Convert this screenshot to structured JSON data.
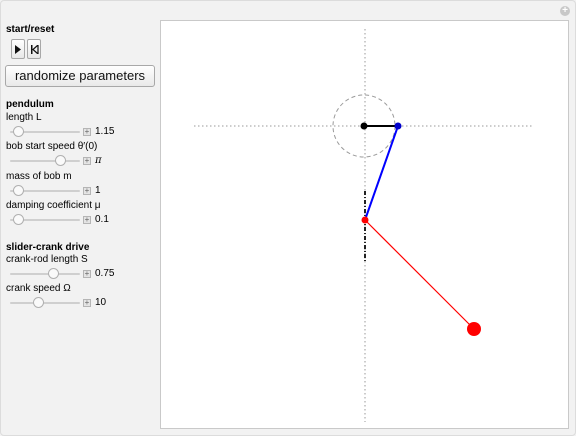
{
  "controls": {
    "start_reset_label": "start/reset",
    "randomize_label": "randomize parameters"
  },
  "pendulum": {
    "title": "pendulum",
    "length_label": "length L",
    "length_value": "1.15",
    "length_fraction": 0.12,
    "start_speed_label": "bob start speed θ′(0)",
    "start_speed_value": "π",
    "start_speed_fraction": 0.72,
    "mass_label": "mass of bob m",
    "mass_value": "1",
    "mass_fraction": 0.12,
    "damping_label": "damping coefficient μ",
    "damping_value": "0.1",
    "damping_fraction": 0.12
  },
  "slider_crank": {
    "title": "slider-crank drive",
    "crank_rod_label": "crank-rod length S",
    "crank_rod_value": "0.75",
    "crank_rod_fraction": 0.62,
    "crank_speed_label": "crank speed Ω",
    "crank_speed_value": "10",
    "crank_speed_fraction": 0.4
  },
  "colors": {
    "crank_arm": "#000000",
    "connecting_rod": "#0000ff",
    "pendulum_rod": "#ff0000",
    "bob": "#ff0000",
    "guides": "#999999"
  }
}
